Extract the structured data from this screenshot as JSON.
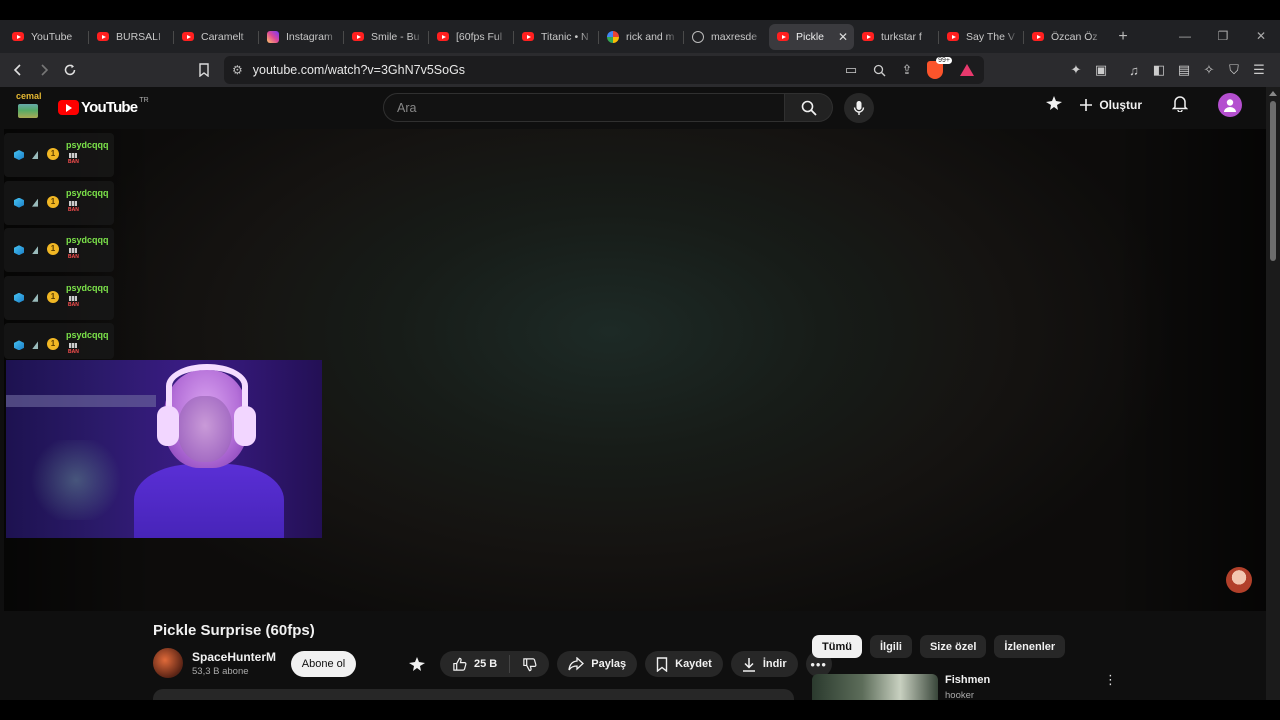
{
  "browser": {
    "tabs": [
      {
        "title": "YouTube",
        "icon": "youtube-icon"
      },
      {
        "title": "BURSALI",
        "icon": "youtube-icon"
      },
      {
        "title": "Caramelt",
        "icon": "youtube-icon"
      },
      {
        "title": "Instagram",
        "icon": "instagram-icon"
      },
      {
        "title": "Smile - Bu",
        "icon": "youtube-icon"
      },
      {
        "title": "[60fps Ful",
        "icon": "youtube-icon"
      },
      {
        "title": "Titanic • N",
        "icon": "youtube-icon"
      },
      {
        "title": "rick and m",
        "icon": "google-icon"
      },
      {
        "title": "maxresde",
        "icon": "globe-icon"
      },
      {
        "title": "Pickle",
        "icon": "youtube-icon",
        "active": true
      },
      {
        "title": "turkstar f",
        "icon": "youtube-icon"
      },
      {
        "title": "Say The V",
        "icon": "youtube-icon"
      },
      {
        "title": "Özcan Öz",
        "icon": "youtube-icon"
      }
    ],
    "url_host": "youtube.com",
    "url_path": "/watch?v=3GhN7v5SoGs",
    "brave_badge": "99+"
  },
  "youtube": {
    "logo_text": "YouTube",
    "region": "TR",
    "search_placeholder": "Ara",
    "create_label": "Oluştur"
  },
  "overlay": {
    "streamer_name": "cemal",
    "chat": [
      {
        "user": "psydcqqq",
        "badge": "1",
        "tag": "BAN"
      },
      {
        "user": "psydcqqq",
        "badge": "1",
        "tag": "BAN"
      },
      {
        "user": "psydcqqq",
        "badge": "1",
        "tag": "BAN"
      },
      {
        "user": "psydcqqq",
        "badge": "1",
        "tag": "BAN"
      },
      {
        "user": "psydcqqq",
        "badge": "1",
        "tag": "BAN"
      }
    ]
  },
  "video": {
    "title": "Pickle Surprise (60fps)",
    "channel": "SpaceHunterM",
    "subscribers": "53,3 B abone",
    "subscribe_label": "Abone ol",
    "likes": "25 B",
    "share_label": "Paylaş",
    "save_label": "Kaydet",
    "download_label": "İndir"
  },
  "sidebar": {
    "chips": [
      "Tümü",
      "İlgili",
      "Size özel",
      "İzlenenler"
    ],
    "recommendation": {
      "title": "Fishmen",
      "channel": "hooker"
    }
  }
}
